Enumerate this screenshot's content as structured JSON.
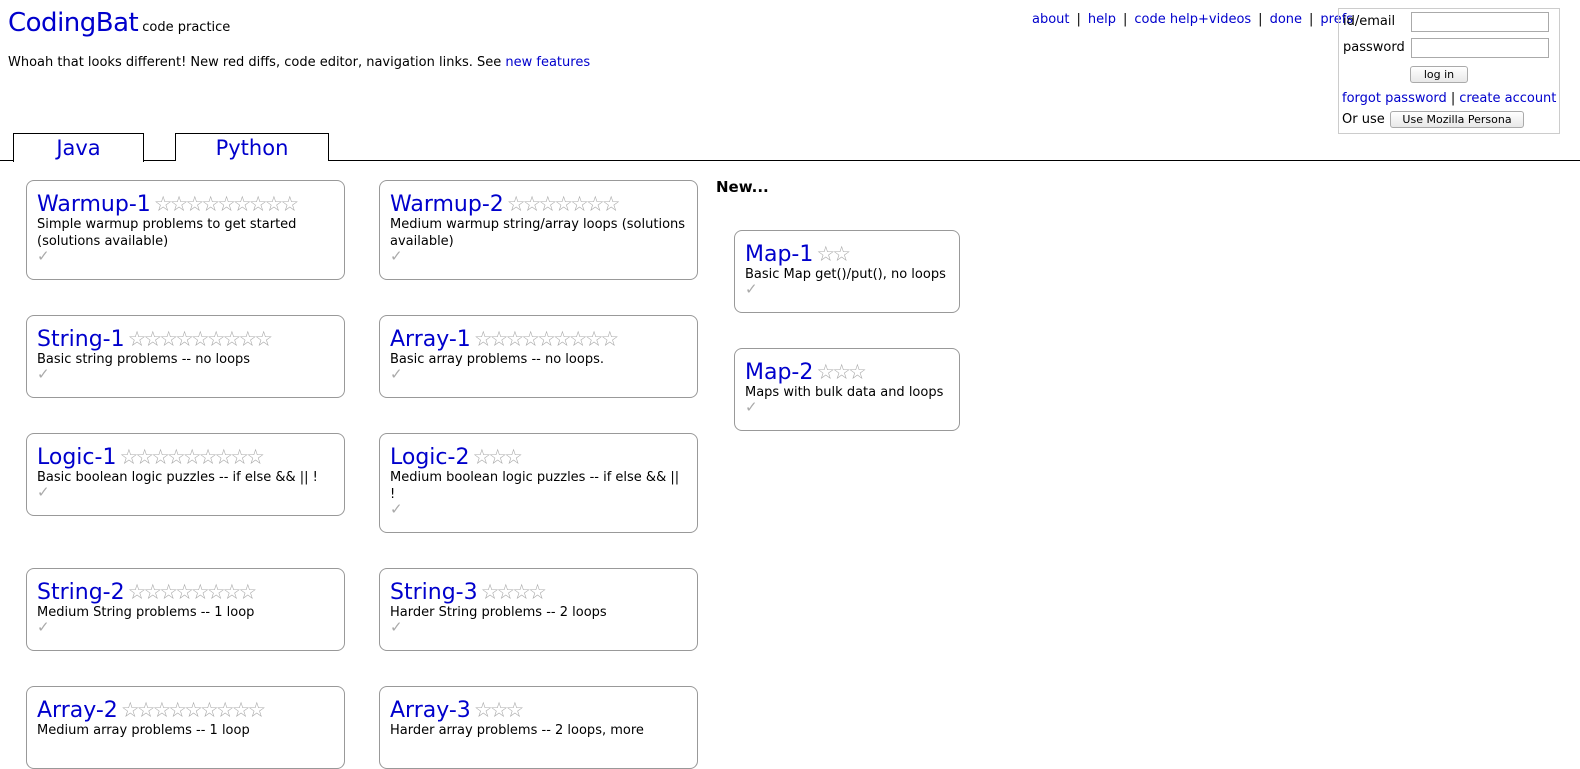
{
  "brand": {
    "logo": "CodingBat",
    "tagline": "code practice"
  },
  "news": {
    "text": "Whoah that looks different! New red diffs, code editor, navigation links. See ",
    "link": "new features"
  },
  "nav": [
    "about",
    "help",
    "code help+videos",
    "done",
    "prefs"
  ],
  "login": {
    "id_label": "id/email",
    "id_value": "",
    "password_label": "password",
    "password_value": "",
    "login_button": "log in",
    "forgot_password": "forgot password",
    "separator": "|",
    "create_account": "create account",
    "or_use": "Or use",
    "persona_button": "Use Mozilla Persona"
  },
  "tabs": [
    {
      "label": "Java",
      "active": true
    },
    {
      "label": "Python",
      "active": false
    }
  ],
  "new_section_label": "New...",
  "check_icon": "✓",
  "cards": [
    {
      "title": "Warmup-1",
      "stars": 9,
      "desc": "Simple warmup problems to get started (solutions available)"
    },
    {
      "title": "Warmup-2",
      "stars": 7,
      "desc": "Medium warmup string/array loops (solutions available)"
    },
    {
      "title": "String-1",
      "stars": 9,
      "desc": "Basic string problems -- no loops"
    },
    {
      "title": "Array-1",
      "stars": 9,
      "desc": "Basic array problems -- no loops."
    },
    {
      "title": "Logic-1",
      "stars": 9,
      "desc": "Basic boolean logic puzzles -- if else && || !"
    },
    {
      "title": "Logic-2",
      "stars": 3,
      "desc": "Medium boolean logic puzzles -- if else && || !"
    },
    {
      "title": "String-2",
      "stars": 8,
      "desc": "Medium String problems -- 1 loop"
    },
    {
      "title": "String-3",
      "stars": 4,
      "desc": "Harder String problems -- 2 loops"
    },
    {
      "title": "Array-2",
      "stars": 9,
      "desc": "Medium array problems -- 1 loop"
    },
    {
      "title": "Array-3",
      "stars": 3,
      "desc": "Harder array problems -- 2 loops, more"
    },
    {
      "title": "Map-1",
      "stars": 2,
      "desc": "Basic Map get()/put(), no loops"
    },
    {
      "title": "Map-2",
      "stars": 3,
      "desc": "Maps with bulk data and loops"
    }
  ]
}
